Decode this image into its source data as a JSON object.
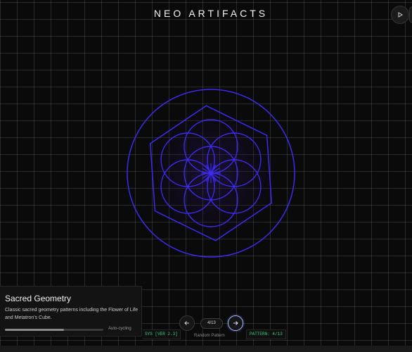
{
  "app": {
    "title": "NEO ARTIFACTS"
  },
  "header": {
    "play_icon": "play-icon"
  },
  "pattern": {
    "name": "Sacred Geometry",
    "description": "Classic sacred geometry patterns including the Flower of Life and Metatron's Cube.",
    "cycle_progress": 0.6,
    "cycle_label": "Auto-cycling",
    "stroke_color": "#3d2bf0"
  },
  "nav": {
    "prev_icon": "arrow-left-icon",
    "next_icon": "arrow-right-icon",
    "counter": "4/13",
    "random_label": "Random Pattern"
  },
  "status": {
    "sys": "SYS [VER 2.3]",
    "pattern": "PATTERN: 4/13",
    "color": "#34d178"
  }
}
